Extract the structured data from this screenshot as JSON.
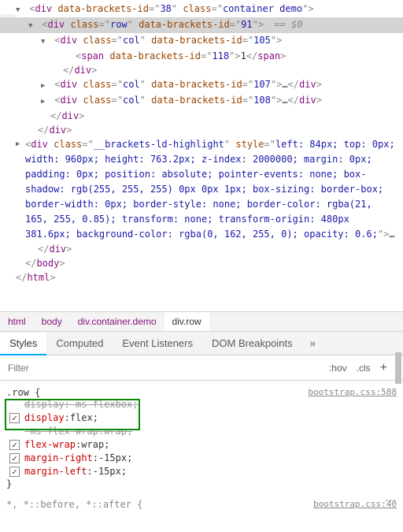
{
  "tree": {
    "gutter_dots": "···",
    "eq0": "== $0",
    "l1": {
      "tag": "div",
      "a1n": "data-brackets-id",
      "a1v": "38",
      "a2n": "class",
      "a2v": "container demo"
    },
    "l2": {
      "tag": "div",
      "a1n": "class",
      "a1v": "row",
      "a2n": "data-brackets-id",
      "a2v": "91"
    },
    "l3": {
      "tag": "div",
      "a1n": "class",
      "a1v": "col",
      "a2n": "data-brackets-id",
      "a2v": "105"
    },
    "l4": {
      "tag": "span",
      "a1n": "data-brackets-id",
      "a1v": "118",
      "text": "1",
      "close": "span"
    },
    "l5": {
      "close": "div"
    },
    "l6": {
      "tag": "div",
      "a1n": "class",
      "a1v": "col",
      "a2n": "data-brackets-id",
      "a2v": "107",
      "ellipsis": "…",
      "close": "div"
    },
    "l7": {
      "tag": "div",
      "a1n": "class",
      "a1v": "col",
      "a2n": "data-brackets-id",
      "a2v": "108",
      "ellipsis": "…",
      "close": "div"
    },
    "l8": {
      "close": "div"
    },
    "l9": {
      "close": "div"
    },
    "l10": {
      "tag": "div",
      "a1n": "class",
      "a1v": "__brackets-ld-highlight",
      "a2n": "style",
      "a2v": "left: 84px; top: 0px; width: 960px; height: 763.2px; z-index: 2000000; margin: 0px; padding: 0px; position: absolute; pointer-events: none; box-shadow: rgb(255, 255, 255) 0px 0px 1px; box-sizing: border-box; border-width: 0px; border-style: none; border-color: rgba(21, 165, 255, 0.85); transform: none; transform-origin: 480px 381.6px; background-color: rgba(0, 162, 255, 0); opacity: 0.6;",
      "ellipsis": "…"
    },
    "l11": {
      "close": "div"
    },
    "l12": {
      "close": "body"
    },
    "l13": {
      "close": "html"
    }
  },
  "breadcrumb": {
    "b1": "html",
    "b2": "body",
    "b3": "div.container.demo",
    "b4": "div.row"
  },
  "tabs": {
    "t1": "Styles",
    "t2": "Computed",
    "t3": "Event Listeners",
    "t4": "DOM Breakpoints",
    "overflow": "»"
  },
  "filter": {
    "placeholder": "Filter",
    "hov": ":hov",
    "cls": ".cls",
    "plus": "+"
  },
  "styles": {
    "rule1": {
      "selector": ".row {",
      "source": "bootstrap.css:588",
      "p1n": "display",
      "p1v": "-ms-flexbox",
      "p2n": "display",
      "p2v": "flex",
      "p3n": "-ms-flex-wrap",
      "p3v": "wrap",
      "p4n": "flex-wrap",
      "p4v": "wrap",
      "p5n": "margin-right",
      "p5v": "-15px",
      "p6n": "margin-left",
      "p6v": "-15px",
      "close": "}"
    },
    "rule2": {
      "selector": "*, *::before, *::after {",
      "source": "bootstrap.css:40"
    },
    "more": "⋮"
  }
}
